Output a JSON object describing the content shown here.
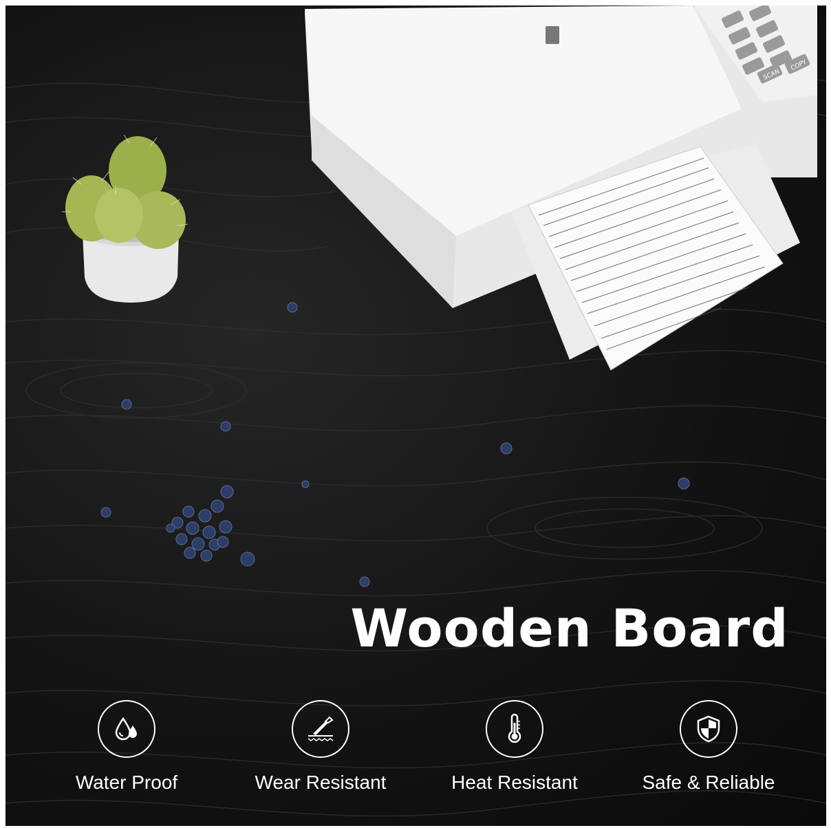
{
  "headline": "Wooden Board",
  "features": [
    {
      "label": "Water Proof",
      "icon": "water-drops-icon"
    },
    {
      "label": "Wear Resistant",
      "icon": "scratch-blade-icon"
    },
    {
      "label": "Heat Resistant",
      "icon": "thermometer-icon"
    },
    {
      "label": "Safe & Reliable",
      "icon": "shield-icon"
    }
  ],
  "printer_buttons": [
    "SCAN",
    "COPY"
  ],
  "colors": {
    "background": "#131313",
    "text": "#ffffff",
    "printer": "#f2f2f2",
    "blueberry": "#2c3d66",
    "cactus": "#9bb04a"
  }
}
